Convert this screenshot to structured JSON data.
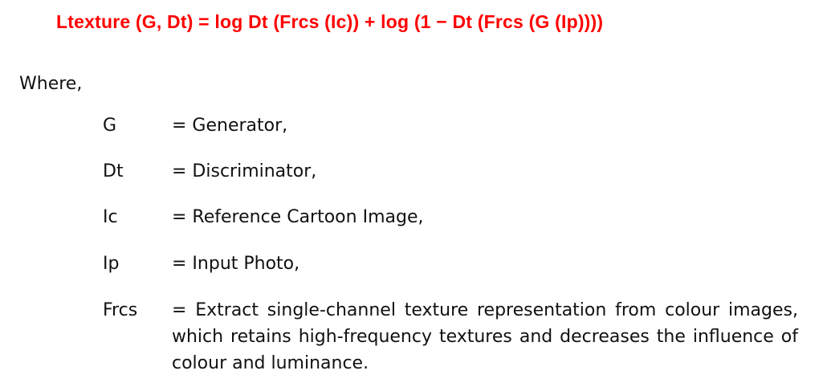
{
  "equation": "Ltexture (G, Dt) = log Dt (Frcs (Ic)) + log (1 − Dt (Frcs (G (Ip))))",
  "where_label": "Where,",
  "definitions": [
    {
      "term": "G",
      "definition": "= Generator,"
    },
    {
      "term": "Dt",
      "definition": "= Discriminator,"
    },
    {
      "term": "Ic",
      "definition": "= Reference Cartoon Image,"
    },
    {
      "term": "Ip",
      "definition": "= Input Photo,"
    },
    {
      "term": "Frcs",
      "definition": "= Extract single-channel texture representation from colour images, which retains high-frequency textures and decreases the influence of colour and luminance."
    }
  ],
  "colors": {
    "equation": "#ff0000"
  }
}
